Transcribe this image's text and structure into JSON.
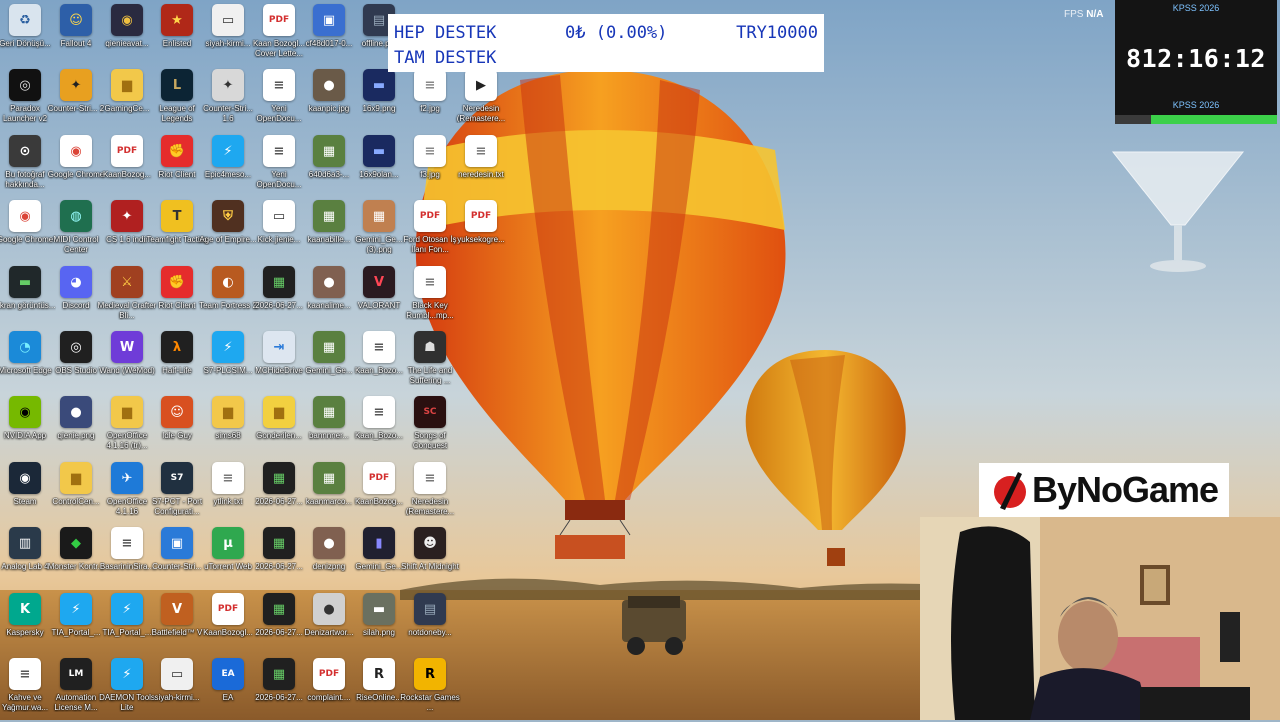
{
  "desktop_icons": [
    {
      "label": "Geri Dönüşü...",
      "color": "#d9e4ee",
      "fg": "#2a5fa0",
      "glyph": "♻",
      "col": 0,
      "row": 0
    },
    {
      "label": "Fallout 4",
      "color": "#2d5fa8",
      "fg": "#ffd84a",
      "glyph": "☺",
      "col": 1,
      "row": 0
    },
    {
      "label": "qienieavat...",
      "color": "#2a2a40",
      "fg": "#f0c040",
      "glyph": "◉",
      "col": 2,
      "row": 0
    },
    {
      "label": "Enlisted",
      "color": "#b02818",
      "fg": "#ffd54a",
      "glyph": "★",
      "col": 3,
      "row": 0
    },
    {
      "label": "siyah-kirmi...",
      "color": "#f0f0f0",
      "fg": "#333",
      "glyph": "▭",
      "col": 4,
      "row": 0
    },
    {
      "label": "Kaan Bozogl... Cover Lette...",
      "color": "#ffffff",
      "fg": "#d32f2f",
      "glyph": "PDF",
      "col": 5,
      "row": 0
    },
    {
      "label": "cf48d017-0...",
      "color": "#3a6fd0",
      "fg": "#fff",
      "glyph": "▣",
      "col": 6,
      "row": 0
    },
    {
      "label": "offline.p...",
      "color": "#303a50",
      "fg": "#9ab",
      "glyph": "▤",
      "col": 7,
      "row": 0
    },
    {
      "label": "Paradox Launcher v2",
      "color": "#111111",
      "fg": "#e0e0e0",
      "glyph": "◎",
      "col": 0,
      "row": 1
    },
    {
      "label": "Counter-Stri... 2",
      "color": "#e8a020",
      "fg": "#222",
      "glyph": "✦",
      "col": 1,
      "row": 1
    },
    {
      "label": "GamingCe...",
      "color": "#f2c84a",
      "fg": "#a07010",
      "glyph": "▆",
      "col": 2,
      "row": 1
    },
    {
      "label": "League of Legends",
      "color": "#0c2434",
      "fg": "#c8a860",
      "glyph": "L",
      "col": 3,
      "row": 1
    },
    {
      "label": "Counter-Stri... 1.6",
      "color": "#d8d8d8",
      "fg": "#333",
      "glyph": "✦",
      "col": 4,
      "row": 1
    },
    {
      "label": "Yeni OpenDocu...",
      "color": "#ffffff",
      "fg": "#555",
      "glyph": "≡",
      "col": 5,
      "row": 1
    },
    {
      "label": "kaanpic.jpg",
      "color": "#6a5a48",
      "fg": "#fff",
      "glyph": "●",
      "col": 6,
      "row": 1
    },
    {
      "label": "16x9.png",
      "color": "#1a2a60",
      "fg": "#8af",
      "glyph": "▬",
      "col": 7,
      "row": 1
    },
    {
      "label": "f2.jpg",
      "color": "#ffffff",
      "fg": "#888",
      "glyph": "≡",
      "col": 8,
      "row": 1
    },
    {
      "label": "Neredesin (Remastere...",
      "color": "#ffffff",
      "fg": "#222",
      "glyph": "▶",
      "col": 9,
      "row": 1
    },
    {
      "label": "Bu fotoğraf hakkında...",
      "color": "#3a3a3a",
      "fg": "#fff",
      "glyph": "⊙",
      "col": 0,
      "row": 2
    },
    {
      "label": "Google Chrome",
      "color": "#ffffff",
      "fg": "#db4437",
      "glyph": "◉",
      "col": 1,
      "row": 2
    },
    {
      "label": "KaanBozog...",
      "color": "#ffffff",
      "fg": "#d32f2f",
      "glyph": "PDF",
      "col": 2,
      "row": 2
    },
    {
      "label": "Riot Client",
      "color": "#e52c2c",
      "fg": "#fff",
      "glyph": "✊",
      "col": 3,
      "row": 2
    },
    {
      "label": "Epic4meso...",
      "color": "#1ea8f0",
      "fg": "#fff",
      "glyph": "⚡",
      "col": 4,
      "row": 2
    },
    {
      "label": "Yeni OpenDocu...",
      "color": "#ffffff",
      "fg": "#555",
      "glyph": "≡",
      "col": 5,
      "row": 2
    },
    {
      "label": "640d6a3-...",
      "color": "#5a8040",
      "fg": "#fff",
      "glyph": "▦",
      "col": 6,
      "row": 2
    },
    {
      "label": "16x9olan...",
      "color": "#1a2a60",
      "fg": "#8af",
      "glyph": "▬",
      "col": 7,
      "row": 2
    },
    {
      "label": "f3.jpg",
      "color": "#ffffff",
      "fg": "#888",
      "glyph": "≡",
      "col": 8,
      "row": 2
    },
    {
      "label": "neredesin.txt",
      "color": "#ffffff",
      "fg": "#777",
      "glyph": "≡",
      "col": 9,
      "row": 2
    },
    {
      "label": "Google Chrome",
      "color": "#ffffff",
      "fg": "#db4437",
      "glyph": "◉",
      "col": 0,
      "row": 3
    },
    {
      "label": "MIDI Control Center",
      "color": "#1f6f4f",
      "fg": "#9ff",
      "glyph": "◍",
      "col": 1,
      "row": 3
    },
    {
      "label": "CS 1.6 indir",
      "color": "#b02020",
      "fg": "#fff",
      "glyph": "✦",
      "col": 2,
      "row": 3
    },
    {
      "label": "Teamfight Tactics",
      "color": "#f0c020",
      "fg": "#333",
      "glyph": "T",
      "col": 3,
      "row": 3
    },
    {
      "label": "Age of Empire...",
      "color": "#503020",
      "fg": "#fc4",
      "glyph": "⛨",
      "col": 4,
      "row": 3
    },
    {
      "label": "Kick.jienie...",
      "color": "#ffffff",
      "fg": "#333",
      "glyph": "▭",
      "col": 5,
      "row": 3
    },
    {
      "label": "kaanabille...",
      "color": "#5a8040",
      "fg": "#fff",
      "glyph": "▦",
      "col": 6,
      "row": 3
    },
    {
      "label": "Gemini_Ge... (3).png",
      "color": "#c08050",
      "fg": "#fff",
      "glyph": "▦",
      "col": 7,
      "row": 3
    },
    {
      "label": "Ford Otosan İş İlanı Fon...",
      "color": "#ffffff",
      "fg": "#d32f2f",
      "glyph": "PDF",
      "col": 8,
      "row": 3
    },
    {
      "label": "yuksekogre...",
      "color": "#ffffff",
      "fg": "#d32f2f",
      "glyph": "PDF",
      "col": 9,
      "row": 3
    },
    {
      "label": "Ekran görüntüs...",
      "color": "#20282a",
      "fg": "#6c6",
      "glyph": "▬",
      "col": 0,
      "row": 4
    },
    {
      "label": "Discord",
      "color": "#5865f2",
      "fg": "#fff",
      "glyph": "◕",
      "col": 1,
      "row": 4
    },
    {
      "label": "Medieval Crafter Bli...",
      "color": "#a04020",
      "fg": "#fc4",
      "glyph": "⚔",
      "col": 2,
      "row": 4
    },
    {
      "label": "Riot Client",
      "color": "#e52c2c",
      "fg": "#fff",
      "glyph": "✊",
      "col": 3,
      "row": 4
    },
    {
      "label": "Team Fortress 2",
      "color": "#b85a20",
      "fg": "#fff",
      "glyph": "◐",
      "col": 4,
      "row": 4
    },
    {
      "label": "2026-06-27...",
      "color": "#202020",
      "fg": "#6c6",
      "glyph": "▦",
      "col": 5,
      "row": 4
    },
    {
      "label": "kaanalime...",
      "color": "#806050",
      "fg": "#fff",
      "glyph": "●",
      "col": 6,
      "row": 4
    },
    {
      "label": "VALORANT",
      "color": "#2a1a20",
      "fg": "#ff4655",
      "glyph": "V",
      "col": 7,
      "row": 4
    },
    {
      "label": "Black Key Rumbl...mp...",
      "color": "#ffffff",
      "fg": "#777",
      "glyph": "≡",
      "col": 8,
      "row": 4
    },
    {
      "label": "Microsoft Edge",
      "color": "#1b8ad8",
      "fg": "#7ef",
      "glyph": "◔",
      "col": 0,
      "row": 5
    },
    {
      "label": "OBS Studio",
      "color": "#202020",
      "fg": "#fff",
      "glyph": "◎",
      "col": 1,
      "row": 5
    },
    {
      "label": "Wand (WeMod)",
      "color": "#6f3cd8",
      "fg": "#fff",
      "glyph": "W",
      "col": 2,
      "row": 5
    },
    {
      "label": "Half-Life",
      "color": "#202020",
      "fg": "#f80",
      "glyph": "λ",
      "col": 3,
      "row": 5
    },
    {
      "label": "S7-PLCSIM...",
      "color": "#1ea8f0",
      "fg": "#fff",
      "glyph": "⚡",
      "col": 4,
      "row": 5
    },
    {
      "label": "MCHideDrive",
      "color": "#dde6f0",
      "fg": "#2a7ad8",
      "glyph": "⇥",
      "col": 5,
      "row": 5
    },
    {
      "label": "Gemini_Ge...",
      "color": "#5a8040",
      "fg": "#fff",
      "glyph": "▦",
      "col": 6,
      "row": 5
    },
    {
      "label": "Kaan_Bozo...",
      "color": "#ffffff",
      "fg": "#555",
      "glyph": "≡",
      "col": 7,
      "row": 5
    },
    {
      "label": "The Life and Suffering ...",
      "color": "#303030",
      "fg": "#ddd",
      "glyph": "☗",
      "col": 8,
      "row": 5
    },
    {
      "label": "NVIDIA App",
      "color": "#76b900",
      "fg": "#000",
      "glyph": "◉",
      "col": 0,
      "row": 6
    },
    {
      "label": "qienie.png",
      "color": "#3a4a7a",
      "fg": "#fff",
      "glyph": "●",
      "col": 1,
      "row": 6
    },
    {
      "label": "OpenOffice 4.1.16 (tr)...",
      "color": "#f2c84a",
      "fg": "#a07010",
      "glyph": "▆",
      "col": 2,
      "row": 6
    },
    {
      "label": "Idle Guy",
      "color": "#d85020",
      "fg": "#fff",
      "glyph": "☺",
      "col": 3,
      "row": 6
    },
    {
      "label": "sims68",
      "color": "#f2c84a",
      "fg": "#a07010",
      "glyph": "▆",
      "col": 4,
      "row": 6
    },
    {
      "label": "Gonderilen...",
      "color": "#f2d040",
      "fg": "#a07010",
      "glyph": "▆",
      "col": 5,
      "row": 6
    },
    {
      "label": "bannnner...",
      "color": "#5a8040",
      "fg": "#fff",
      "glyph": "▦",
      "col": 6,
      "row": 6
    },
    {
      "label": "Kaan_Bozo...",
      "color": "#ffffff",
      "fg": "#555",
      "glyph": "≡",
      "col": 7,
      "row": 6
    },
    {
      "label": "Songs of Conquest",
      "color": "#2a1010",
      "fg": "#d44",
      "glyph": "SC",
      "col": 8,
      "row": 6
    },
    {
      "label": "Steam",
      "color": "#1b2838",
      "fg": "#fff",
      "glyph": "◉",
      "col": 0,
      "row": 7
    },
    {
      "label": "ControlCen...",
      "color": "#f2c84a",
      "fg": "#a07010",
      "glyph": "▆",
      "col": 1,
      "row": 7
    },
    {
      "label": "OpenOffice 4.1.16",
      "color": "#1e7ad8",
      "fg": "#fff",
      "glyph": "✈",
      "col": 2,
      "row": 7
    },
    {
      "label": "S7-PCT - Port Configurati...",
      "color": "#203040",
      "fg": "#fff",
      "glyph": "S7",
      "col": 3,
      "row": 7
    },
    {
      "label": "ytlink.txt",
      "color": "#ffffff",
      "fg": "#777",
      "glyph": "≡",
      "col": 4,
      "row": 7
    },
    {
      "label": "2026-06-27...",
      "color": "#202020",
      "fg": "#6c6",
      "glyph": "▦",
      "col": 5,
      "row": 7
    },
    {
      "label": "kaanmarco...",
      "color": "#5a8040",
      "fg": "#fff",
      "glyph": "▦",
      "col": 6,
      "row": 7
    },
    {
      "label": "KaanBozog...",
      "color": "#ffffff",
      "fg": "#d32f2f",
      "glyph": "PDF",
      "col": 7,
      "row": 7
    },
    {
      "label": "Neredesin (Remastere...",
      "color": "#ffffff",
      "fg": "#777",
      "glyph": "≡",
      "col": 8,
      "row": 7
    },
    {
      "label": "Analog Lab 4",
      "color": "#2a3a4a",
      "fg": "#fff",
      "glyph": "▥",
      "col": 0,
      "row": 8
    },
    {
      "label": "Monster Kontr...",
      "color": "#1a1a1a",
      "fg": "#3c4",
      "glyph": "◆",
      "col": 1,
      "row": 8
    },
    {
      "label": "BasarininSira...",
      "color": "#ffffff",
      "fg": "#555",
      "glyph": "≡",
      "col": 2,
      "row": 8
    },
    {
      "label": "Counter-Stri...",
      "color": "#2a7ad8",
      "fg": "#fff",
      "glyph": "▣",
      "col": 3,
      "row": 8
    },
    {
      "label": "uTorrent Web",
      "color": "#2fa84f",
      "fg": "#fff",
      "glyph": "µ",
      "col": 4,
      "row": 8
    },
    {
      "label": "2026-06-27...",
      "color": "#202020",
      "fg": "#6c6",
      "glyph": "▦",
      "col": 5,
      "row": 8
    },
    {
      "label": "denizpng",
      "color": "#806050",
      "fg": "#fff",
      "glyph": "●",
      "col": 6,
      "row": 8
    },
    {
      "label": "Gemini_Ge...",
      "color": "#202030",
      "fg": "#88f",
      "glyph": "▮",
      "col": 7,
      "row": 8
    },
    {
      "label": "Shift At Midnight",
      "color": "#2a2020",
      "fg": "#eee",
      "glyph": "☻",
      "col": 8,
      "row": 8
    },
    {
      "label": "Kaspersky",
      "color": "#00a88e",
      "fg": "#fff",
      "glyph": "K",
      "col": 0,
      "row": 9
    },
    {
      "label": "TIA_Portal_...",
      "color": "#1ea8f0",
      "fg": "#fff",
      "glyph": "⚡",
      "col": 1,
      "row": 9
    },
    {
      "label": "TIA_Portal_...",
      "color": "#1ea8f0",
      "fg": "#fff",
      "glyph": "⚡",
      "col": 2,
      "row": 9
    },
    {
      "label": "Battlefield™ V",
      "color": "#c06020",
      "fg": "#fff",
      "glyph": "V",
      "col": 3,
      "row": 9
    },
    {
      "label": "KaanBozogl...",
      "color": "#ffffff",
      "fg": "#d32f2f",
      "glyph": "PDF",
      "col": 4,
      "row": 9
    },
    {
      "label": "2026-06-27...",
      "color": "#202020",
      "fg": "#6c6",
      "glyph": "▦",
      "col": 5,
      "row": 9
    },
    {
      "label": "Denizartwor...",
      "color": "#d0d0d0",
      "fg": "#333",
      "glyph": "●",
      "col": 6,
      "row": 9
    },
    {
      "label": "silah.png",
      "color": "#6a7060",
      "fg": "#fff",
      "glyph": "▬",
      "col": 7,
      "row": 9
    },
    {
      "label": "notdoneby...",
      "color": "#303a50",
      "fg": "#9ab",
      "glyph": "▤",
      "col": 8,
      "row": 9
    },
    {
      "label": "Kahve ve Yağmur.wa...",
      "color": "#ffffff",
      "fg": "#555",
      "glyph": "≡",
      "col": 0,
      "row": 10
    },
    {
      "label": "Automation License M...",
      "color": "#202020",
      "fg": "#fff",
      "glyph": "LM",
      "col": 1,
      "row": 10
    },
    {
      "label": "DAEMON Tools Lite",
      "color": "#1ea8f0",
      "fg": "#fff",
      "glyph": "⚡",
      "col": 2,
      "row": 10
    },
    {
      "label": "siyah-kirmi...",
      "color": "#f0f0f0",
      "fg": "#333",
      "glyph": "▭",
      "col": 3,
      "row": 10
    },
    {
      "label": "EA",
      "color": "#1a6ad8",
      "fg": "#fff",
      "glyph": "EA",
      "col": 4,
      "row": 10
    },
    {
      "label": "2026-06-27...",
      "color": "#202020",
      "fg": "#6c6",
      "glyph": "▦",
      "col": 5,
      "row": 10
    },
    {
      "label": "complaint....",
      "color": "#ffffff",
      "fg": "#d32f2f",
      "glyph": "PDF",
      "col": 6,
      "row": 10
    },
    {
      "label": "RiseOnline...",
      "color": "#ffffff",
      "fg": "#222",
      "glyph": "R",
      "col": 7,
      "row": 10
    },
    {
      "label": "Rockstar Games ...",
      "color": "#f2b400",
      "fg": "#000",
      "glyph": "R",
      "col": 8,
      "row": 10
    }
  ],
  "donation_banner": {
    "line1_left": "HEP DESTEK",
    "line1_middle": "0₺ (0.00%)",
    "line1_right": "TRY10000",
    "line2": "TAM DESTEK",
    "progress_fraction": 0.0
  },
  "timer_widget": {
    "title_top": "KPSS 2026",
    "clock": "812:16:12",
    "title_bottom": "KPSS 2026",
    "bar_fill_fraction": 0.78
  },
  "fps": {
    "label": "FPS",
    "value": "N/A"
  },
  "logo": {
    "text": "ByNoGame"
  },
  "colors": {
    "banner_text": "#1736b8",
    "timer_bg": "#141414",
    "timer_bar": "#3cd04a",
    "sky_top": "#8fb0cc",
    "savanna": "#c88a40"
  }
}
